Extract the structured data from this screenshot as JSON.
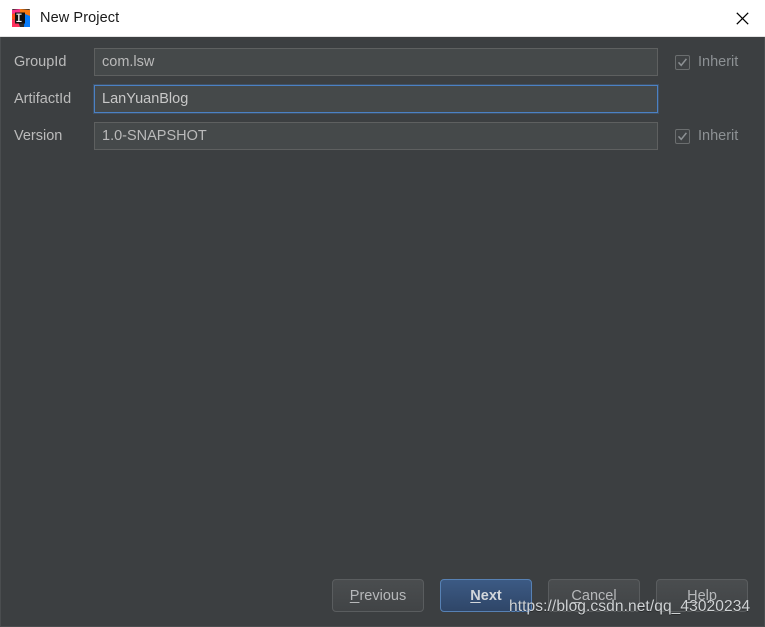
{
  "window": {
    "title": "New Project",
    "app_icon": "intellij-idea-icon",
    "close_label": "×"
  },
  "form": {
    "rows": [
      {
        "label": "GroupId",
        "value": "com.lsw",
        "placeholder": "",
        "focused": false,
        "inherit": {
          "label": "Inherit",
          "checked": true,
          "enabled": false
        }
      },
      {
        "label": "ArtifactId",
        "value": "LanYuanBlog",
        "placeholder": "",
        "focused": true,
        "inherit": null
      },
      {
        "label": "Version",
        "value": "1.0-SNAPSHOT",
        "placeholder": "",
        "focused": false,
        "inherit": {
          "label": "Inherit",
          "checked": true,
          "enabled": false
        }
      }
    ]
  },
  "buttons": {
    "previous": "Previous",
    "next": "Next",
    "cancel": "Cancel",
    "help": "Help"
  },
  "watermark": "https://blog.csdn.net/qq_43020234",
  "colors": {
    "dialog_background": "#3c3f41",
    "titlebar_background": "#ffffff",
    "field_background": "#45494a",
    "focus_border": "#4b81c4",
    "default_button": "#3c5a84",
    "label_text": "#bbbbbb"
  }
}
